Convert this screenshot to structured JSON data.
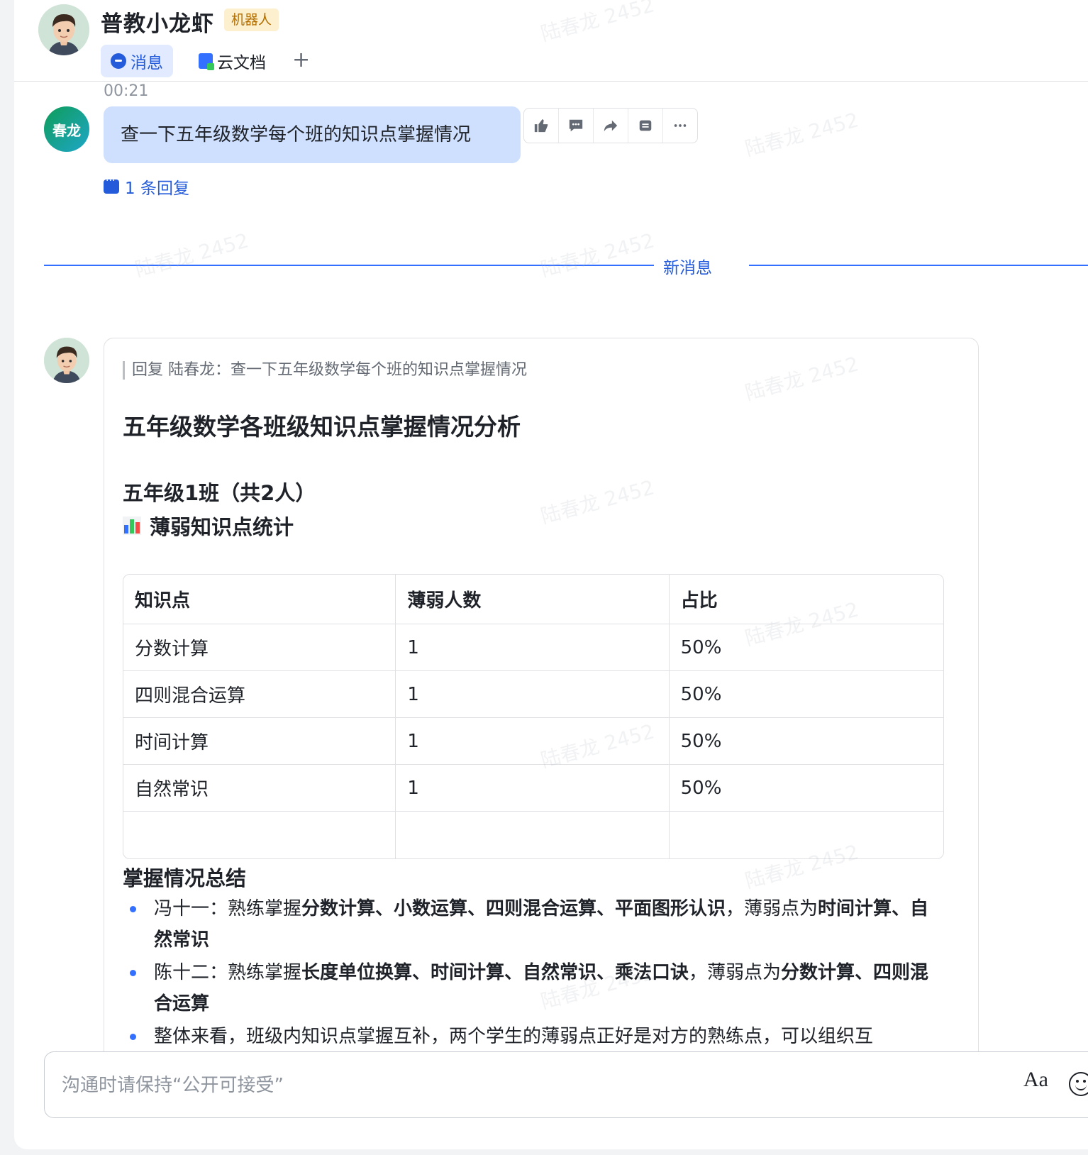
{
  "header": {
    "title": "普教小龙虾",
    "badge": "机器人",
    "tabs": [
      {
        "label": "消息"
      },
      {
        "label": "云文档"
      }
    ],
    "add_tab": "+"
  },
  "first_message": {
    "time": "00:21",
    "avatar_text": "春龙",
    "text": "查一下五年级数学每个班的知识点掌握情况",
    "reply_count": "1 条回复",
    "actions": [
      "thumbs-up-icon",
      "comment-icon",
      "forward-icon",
      "pin-icon",
      "more-icon"
    ]
  },
  "divider": {
    "label": "新消息"
  },
  "reply": {
    "quote": "回复 陆春龙：查一下五年级数学每个班的知识点掌握情况",
    "title": "五年级数学各班级知识点掌握情况分析",
    "class_heading": "五年级1班（共2人）",
    "section_heading": "薄弱知识点统计",
    "table": {
      "headers": [
        "知识点",
        "薄弱人数",
        "占比"
      ],
      "rows": [
        [
          "分数计算",
          "1",
          "50%"
        ],
        [
          "四则混合运算",
          "1",
          "50%"
        ],
        [
          "时间计算",
          "1",
          "50%"
        ],
        [
          "自然常识",
          "1",
          "50%"
        ],
        [
          "",
          "",
          ""
        ]
      ]
    },
    "summary_heading": "掌握情况总结",
    "summary": [
      {
        "p1": "冯十一：熟练掌握",
        "b1": "分数计算、小数运算、四则混合运算、平面图形认识",
        "p2": "，薄弱点为",
        "b2": "时间计算、自然常识"
      },
      {
        "p1": "陈十二：熟练掌握",
        "b1": "长度单位换算、时间计算、自然常识、乘法口诀",
        "p2": "，薄弱点为",
        "b2": "分数计算、四则混合运算"
      },
      {
        "p1": "整体来看，班级内知识点掌握互补，两个学生的薄弱点正好是对方的熟练点，可以组织互",
        "b1": "",
        "p2": "",
        "b2": ""
      }
    ]
  },
  "composer": {
    "placeholder": "沟通时请保持“公开可接受”",
    "format_label": "Aa"
  },
  "watermark": "陆春龙 2452",
  "colors": {
    "accent": "#245bdb",
    "bubble": "#cfe0ff",
    "badge_bg": "#fdf0cf",
    "badge_text": "#b26e00"
  }
}
